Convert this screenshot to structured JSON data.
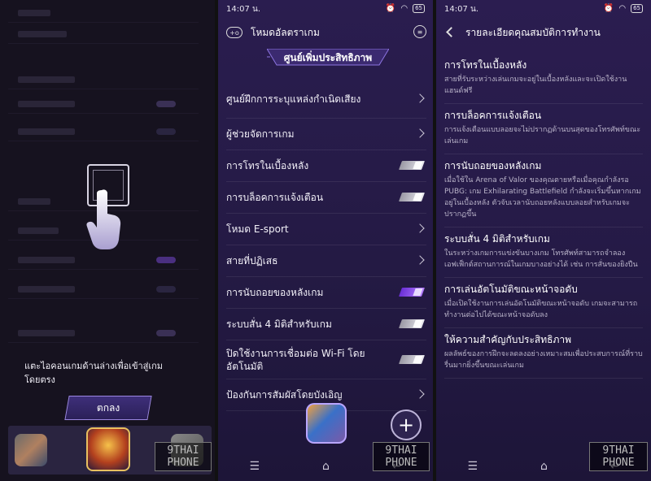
{
  "panel1": {
    "hint_text": "แตะไอคอนเกมด้านล่างเพื่อเข้าสู่เกมโดยตรง",
    "ok_button": "ตกลง"
  },
  "panel2": {
    "time": "14:07 น.",
    "battery": "65",
    "title": "โหมดอัลตราเกม",
    "banner": "ศูนย์เพิ่มประสิทธิภาพ",
    "rows": [
      {
        "label": "ศูนย์ฝึกการระบุแหล่งกำเนิดเสียง",
        "control": "chevron"
      },
      {
        "label": "ผู้ช่วยจัดการเกม",
        "control": "chevron"
      },
      {
        "label": "การโทรในเบื้องหลัง",
        "control": "toggle",
        "on": false
      },
      {
        "label": "การบล็อคการแจ้งเตือน",
        "control": "toggle",
        "on": false
      },
      {
        "label": "โหมด E-sport",
        "control": "chevron"
      },
      {
        "label": "สายที่ปฏิเสธ",
        "control": "chevron"
      },
      {
        "label": "การนับถอยของหลังเกม",
        "control": "toggle",
        "on": true
      },
      {
        "label": "ระบบสั่น 4 มิติสำหรับเกม",
        "control": "toggle",
        "on": false
      },
      {
        "label": "ปิดใช้งานการเชื่อมต่อ Wi-Fi โดยอัตโนมัติ",
        "control": "toggle",
        "on": false
      },
      {
        "label": "ป้องกันการสัมผัสโดยบังเอิญ",
        "control": "chevron"
      }
    ],
    "watermark": "9THAI PHONE"
  },
  "panel3": {
    "time": "14:07 น.",
    "battery": "65",
    "title": "รายละเอียดคุณสมบัติการทำงาน",
    "items": [
      {
        "heading": "การโทรในเบื้องหลัง",
        "desc": "สายที่รับระหว่างเล่นเกมจะอยู่ในเบื้องหลังและจะเปิดใช้งานแฮนด์ฟรี"
      },
      {
        "heading": "การบล็อคการแจ้งเตือน",
        "desc": "การแจ้งเตือนแบบลอยจะไม่ปรากฏด้านบนสุดของโทรศัพท์ขณะเล่นเกม"
      },
      {
        "heading": "การนับถอยของหลังเกม",
        "desc": "เมื่อใช้ใน Arena of Valor ของคุณตายหรือเมื่อคุณกำลังรอ PUBG: เกม Exhilarating Battlefield กำลังจะเริ่มขึ้นหากเกมอยู่ในเบื้องหลัง ตัวจับเวลานับถอยหลังแบบลอยสำหรับเกมจะปรากฏขึ้น"
      },
      {
        "heading": "ระบบสั่น 4 มิติสำหรับเกม",
        "desc": "ในระหว่างเกมการแข่งขันบางเกม โทรศัพท์สามารถจำลองเอฟเฟ็กต์สถานการณ์ในเกมบางอย่างได้ เช่น การสั่นของยิงปืน"
      },
      {
        "heading": "การเล่นอัตโนมัติขณะหน้าจอดับ",
        "desc": "เมื่อเปิดใช้งานการเล่นอัตโนมัติขณะหน้าจอดับ เกมจะสามารถทำงานต่อไปได้ขณะหน้าจอดับลง"
      },
      {
        "heading": "ให้ความสำคัญกับประสิทธิภาพ",
        "desc": "ผลลัพธ์ของการฝึกจะลดลงอย่างเหมาะสมเพื่อประสบการณ์ที่ราบรื่นมากยิ่งขึ้นขณะเล่นเกม"
      }
    ],
    "watermark": "9THAI PHONE"
  }
}
